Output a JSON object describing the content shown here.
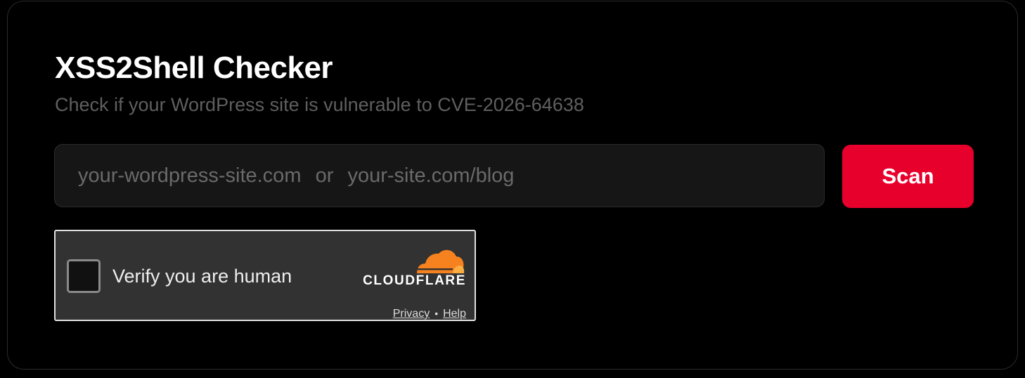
{
  "header": {
    "title": "XSS2Shell Checker",
    "subtitle": "Check if your WordPress site is vulnerable to CVE-2026-64638"
  },
  "scan_form": {
    "url_input": {
      "value": "",
      "placeholder": "your-wordpress-site.com  or  your-site.com/blog"
    },
    "scan_label": "Scan"
  },
  "turnstile": {
    "checked": false,
    "label": "Verify you are human",
    "brand": "CLOUDFLARE",
    "privacy_label": "Privacy",
    "separator": "•",
    "help_label": "Help"
  },
  "colors": {
    "background": "#000000",
    "accent": "#e8002d",
    "input_bg": "#161616",
    "widget_bg": "#323232",
    "cloudflare_orange": "#f6821f"
  },
  "icons": {
    "logo": "cloudflare-cloud-icon"
  }
}
